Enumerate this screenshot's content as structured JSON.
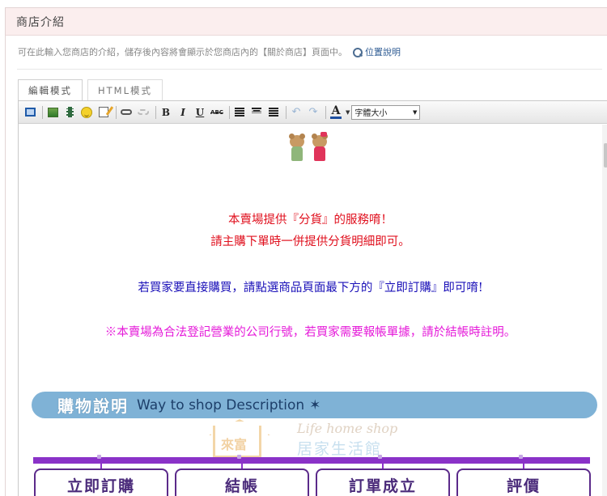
{
  "section": {
    "title": "商店介紹"
  },
  "description": {
    "text": "可在此輸入您商店的介紹，儲存後內容將會顯示於您商店內的【關於商店】頁面中。",
    "link": "位置說明"
  },
  "tabs": [
    {
      "label": "編輯模式",
      "active": true
    },
    {
      "label": "HTML模式",
      "active": false
    }
  ],
  "toolbar": {
    "bold": "B",
    "italic": "I",
    "underline": "U",
    "strike": "ABC",
    "color": "A",
    "font_size_select": "字體大小"
  },
  "content": {
    "line1": "本賣場提供『分貨』的服務唷！",
    "line2": "請主購下單時一併提供分貨明細即可。",
    "line3": "若買家要直接購買，請點選商品頁面最下方的『立即訂購』即可唷!",
    "line4": "※本賣場為合法登記營業的公司行號，若買家需要報帳單據，請於結帳時註明。",
    "colors": {
      "red": "#e0101e",
      "blue": "#1a10b8",
      "magenta": "#e51ad9"
    },
    "banner": {
      "zh": "購物說明",
      "en": "Way to shop Description",
      "star": "✶"
    },
    "logo": {
      "house_text": "來富",
      "en": "Life home shop",
      "zh": "居家生活館"
    },
    "steps": [
      "立即訂購",
      "結帳",
      "訂單成立",
      "評價"
    ]
  }
}
